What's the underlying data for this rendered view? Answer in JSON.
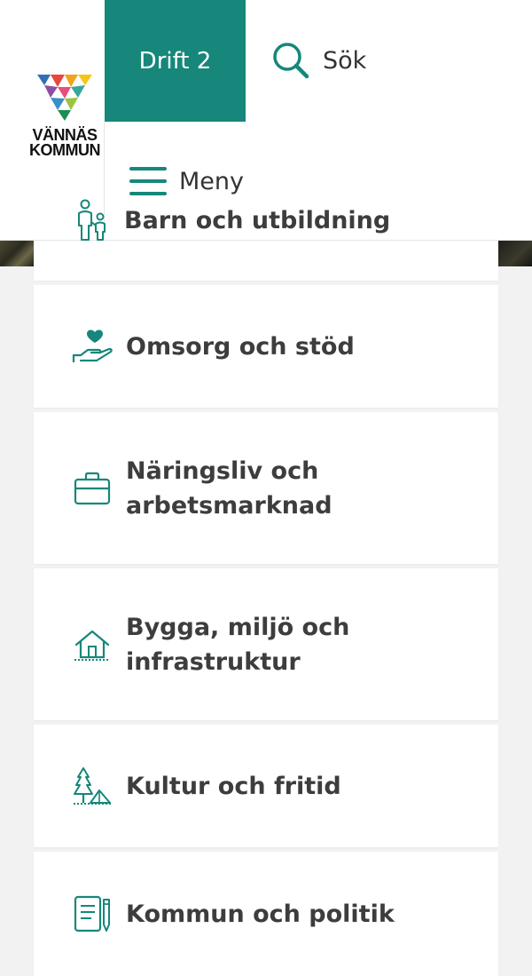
{
  "logo": {
    "line1": "VÄNNÄS",
    "line2": "KOMMUN"
  },
  "header": {
    "drift_tab": "Drift 2",
    "search_label": "Sök",
    "menu_label": "Meny"
  },
  "categories": [
    {
      "title": "Barn och utbildning",
      "icon": "parent-child-icon"
    },
    {
      "title": "Omsorg och stöd",
      "icon": "heart-hand-icon"
    },
    {
      "title": "Näringsliv och arbetsmarknad",
      "icon": "briefcase-icon"
    },
    {
      "title": "Bygga, miljö och infrastruktur",
      "icon": "house-icon"
    },
    {
      "title": "Kultur och fritid",
      "icon": "tree-tent-icon"
    },
    {
      "title": "Kommun och politik",
      "icon": "document-pen-icon"
    }
  ],
  "colors": {
    "accent": "#16877a",
    "text": "#3d3d3d",
    "background": "#f2f2f2"
  }
}
